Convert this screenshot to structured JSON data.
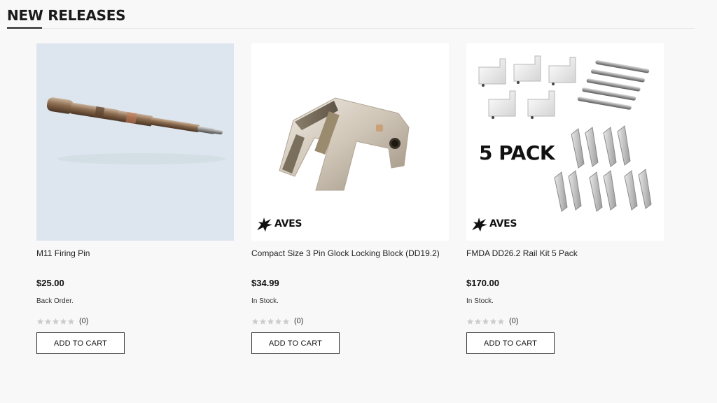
{
  "section": {
    "title": "NEW RELEASES"
  },
  "products": [
    {
      "name": "M11 Firing Pin",
      "price": "$25.00",
      "stock": "Back Order.",
      "rating_count": "(0)",
      "button_label": "ADD TO CART",
      "image_icon": "firing-pin-image"
    },
    {
      "name": "Compact Size 3 Pin Glock Locking Block (DD19.2)",
      "price": "$34.99",
      "stock": "In Stock.",
      "rating_count": "(0)",
      "button_label": "ADD TO CART",
      "image_icon": "locking-block-image",
      "brand_logo": "AVES"
    },
    {
      "name": "FMDA DD26.2 Rail Kit 5 Pack",
      "price": "$170.00",
      "stock": "In Stock.",
      "rating_count": "(0)",
      "button_label": "ADD TO CART",
      "image_icon": "rail-kit-image",
      "image_overlay_text": "5 PACK",
      "brand_logo": "AVES"
    }
  ],
  "colors": {
    "background": "#f8f8f8",
    "text": "#222222",
    "star": "#cccccc",
    "button_border": "#333333"
  }
}
